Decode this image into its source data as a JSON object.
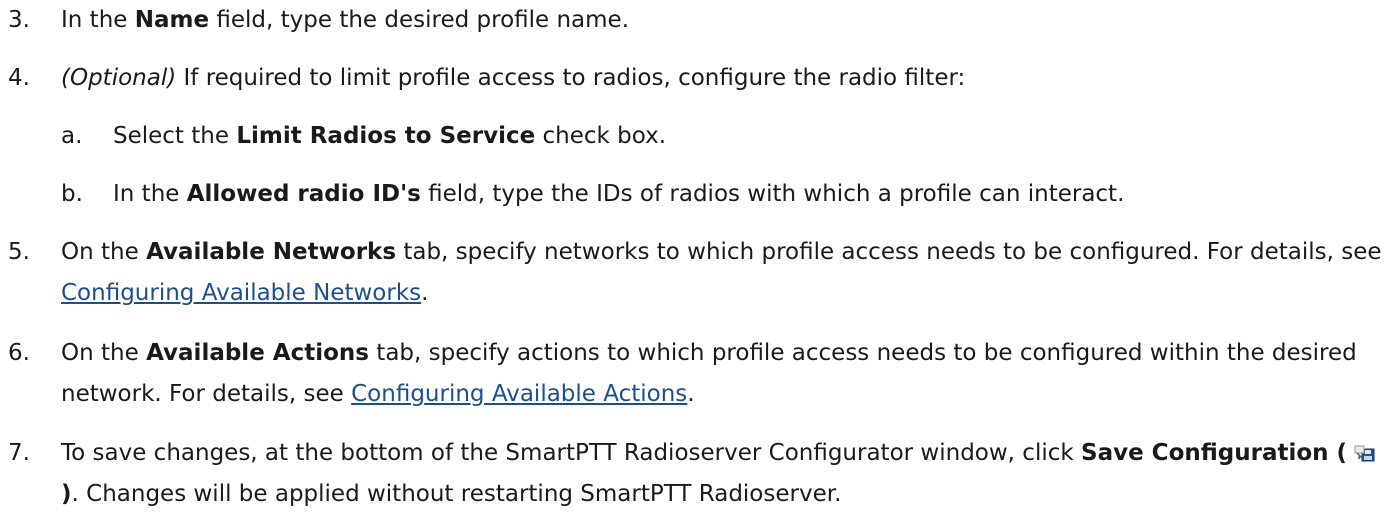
{
  "steps": [
    {
      "num": "3.",
      "pre": "In the ",
      "b1": "Name",
      "post": " field, type the desired profile name."
    },
    {
      "num": "4.",
      "opt": "(Optional)",
      "post": " If required to limit profile access to radios, configure the radio filter:"
    },
    {
      "num": "a.",
      "pre": "Select the ",
      "b1": "Limit Radios to Service",
      "post": " check box."
    },
    {
      "num": "b.",
      "pre": "In the ",
      "b1": "Allowed radio ID's",
      "post": " field, type the IDs of radios with which a profile can interact."
    },
    {
      "num": "5.",
      "pre": "On the ",
      "b1": "Available Networks",
      "mid": " tab, specify networks to which profile access needs to be configured. For details, see ",
      "link": "Configuring Available Networks",
      "post": "."
    },
    {
      "num": "6.",
      "pre": "On the ",
      "b1": "Available Actions",
      "mid": " tab, specify actions to which profile access needs to be configured within the desired network. For details, see ",
      "link": "Configuring Available Actions",
      "post": "."
    },
    {
      "num": "7.",
      "pre": "To save changes, at the bottom of the SmartPTT Radioserver Configurator window, click ",
      "b1": "Save Configuration (",
      "icon": "save-configuration-icon",
      "b2": ")",
      "post": ". Changes will be applied without restarting SmartPTT Radioserver."
    }
  ],
  "colors": {
    "link": "#1e4e8c",
    "text": "#1a1a1a"
  }
}
